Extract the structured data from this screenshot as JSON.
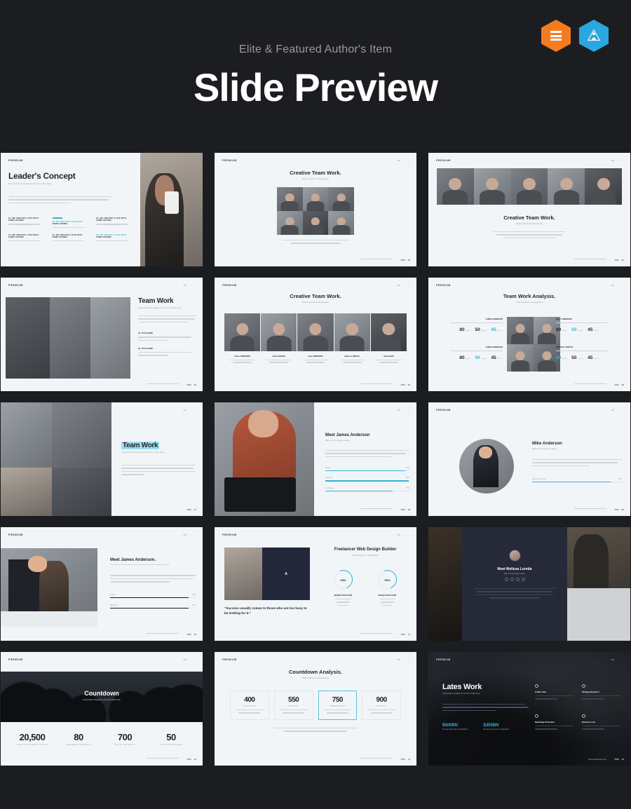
{
  "header": {
    "subtitle": "Elite & Featured Author's Item",
    "title": "Slide Preview",
    "badges": [
      {
        "name": "envato-elite-badge",
        "color": "#f47c20"
      },
      {
        "name": "featured-author-badge",
        "color": "#2ba6de"
      }
    ]
  },
  "slides": [
    {
      "id": "slide-1",
      "brand": "PREMIUM",
      "title": "Leader's Concept",
      "subtitle": "Presentation Template by Premium Slide Shop",
      "nav": "PR",
      "page": "01",
      "columns": [
        {
          "label": "01. WE CREATED A SITE WITH",
          "label2": "FUNNY LETTERS",
          "accent": false
        },
        {
          "label": "02. WE CREATED A SITE WITH",
          "label2": "FUNNY LETTERS",
          "accent": true
        },
        {
          "label": "03. WE CREATED A SITE WITH",
          "label2": "FUNNY LETTERS",
          "accent": false
        },
        {
          "label": "04. WE CREATED A SITE WITH",
          "label2": "FUNNY LETTERS",
          "accent": false
        },
        {
          "label": "05. WE CREATED A SITE WITH",
          "label2": "FUNNY LETTERS",
          "accent": false
        },
        {
          "label": "06. WE CREATED A SITE WITH",
          "label2": "FUNNY LETTERS",
          "accent": true
        }
      ]
    },
    {
      "id": "slide-2",
      "brand": "PREMIUM",
      "title": "Creative Team Work.",
      "subtitle": "Slide Analysis & Infographics",
      "page": "02"
    },
    {
      "id": "slide-3",
      "brand": "PREMIUM",
      "title": "Creative Team Work.",
      "subtitle": "Slide Analysis & Infographics",
      "page": "03"
    },
    {
      "id": "slide-4",
      "brand": "PREMIUM",
      "title": "Team Work",
      "subtitle": "Presentation Template by Premium Slide Shop",
      "items": [
        {
          "label": "01. TITLE HERE"
        },
        {
          "label": "02. TITLE HERE"
        }
      ],
      "page": "04"
    },
    {
      "id": "slide-5",
      "brand": "PREMIUM",
      "title": "Creative Team Work.",
      "subtitle": "Slide Analysis & Infographics",
      "members": [
        {
          "name": "James ANDERSON",
          "role": "Lorem ipsum dolor sit amet"
        },
        {
          "name": "David ARCHER",
          "role": "Lorem ipsum dolor sit amet"
        },
        {
          "name": "Sean ANDERSON",
          "role": "Lorem ipsum dolor sit amet"
        },
        {
          "name": "Melissa LORETTA",
          "role": "Lorem ipsum dolor sit amet"
        },
        {
          "name": "Sean DAVID",
          "role": "Lorem ipsum dolor sit amet"
        }
      ],
      "page": "05"
    },
    {
      "id": "slide-6",
      "brand": "PREMIUM",
      "title": "Team Work Analysis.",
      "subtitle": "Slide Analysis & Infographics",
      "people": [
        {
          "name": "JAMES ANDERSON",
          "values": [
            "80",
            "50",
            "45"
          ],
          "accentIndex": 2
        },
        {
          "name": "BILLY ANDERSON",
          "values": [
            "80",
            "50",
            "45"
          ],
          "accentIndex": 1
        },
        {
          "name": "JAMES ANDERSON",
          "values": [
            "80",
            "50",
            "45"
          ],
          "accentIndex": 1
        },
        {
          "name": "MELISSA LORETTA",
          "values": [
            "80",
            "50",
            "45"
          ],
          "accentIndex": 0
        }
      ],
      "units": [
        "Projects",
        "Progress",
        "Success"
      ],
      "page": "06"
    },
    {
      "id": "slide-7",
      "brand": "PREMIUM",
      "title": "Team Work",
      "subtitle": "Presentation Template by Premium Slide Shop",
      "page": "07"
    },
    {
      "id": "slide-8",
      "brand": "PREMIUM",
      "title": "Meet James Anderson",
      "subtitle": "Elite & Technology Leader",
      "bars": [
        {
          "label": "Design",
          "value": "90%",
          "pct": 90
        },
        {
          "label": "Marketing",
          "value": "85%",
          "pct": 85
        },
        {
          "label": "Technology",
          "value": "75%",
          "pct": 75
        }
      ],
      "page": "08"
    },
    {
      "id": "slide-9",
      "brand": "PREMIUM",
      "title": "Mike Anderson",
      "subtitle": "Elite & Technology Leader",
      "bars": [
        {
          "label": "Business Process",
          "value": "80%",
          "pct": 80
        }
      ],
      "page": "09"
    },
    {
      "id": "slide-10",
      "brand": "PREMIUM",
      "title": "Meet James Anderson.",
      "subtitle": "Presentation Template by Premium",
      "bars": [
        {
          "label": "Design",
          "value": "90%",
          "pct": 90
        },
        {
          "label": "Marketing",
          "value": "80%",
          "pct": 80
        }
      ],
      "page": "10"
    },
    {
      "id": "slide-11",
      "brand": "PREMIUM",
      "title": "Freelancer Web Design Builder",
      "subtitle": "Slide Analysis & Infographics",
      "quote": "\"Success usually comes to those who are too busy to be looking for it.\"",
      "rings": [
        {
          "pct": "65%",
          "caption": "Lorem ipsum dolor",
          "label": "DESIGN STRUCTURE"
        },
        {
          "pct": "90%",
          "caption": "Lorem ipsum dolor",
          "label": "DESIGN STRUCTURE"
        }
      ],
      "page": "11"
    },
    {
      "id": "slide-12",
      "brand": "PREMIUM",
      "title": "Meet Melissa Loretta",
      "subtitle": "Elite & Technology Leader",
      "page": "12"
    },
    {
      "id": "slide-13",
      "brand": "PREMIUM",
      "title": "Countdown",
      "subtitle": "Presentation Template by Premium Slide Shop",
      "stats": [
        {
          "value": "20,500",
          "label": "HAPPY BUSINESS CLIENTS",
          "accent": false
        },
        {
          "value": "80",
          "label": "AWARDED PROJECTS",
          "accent": false
        },
        {
          "value": "700",
          "label": "SOCIAL PROJECTS",
          "accent": true
        },
        {
          "value": "50",
          "label": "SOLUTION PROCESS",
          "accent": false
        }
      ],
      "page": "13"
    },
    {
      "id": "slide-14",
      "brand": "PREMIUM",
      "title": "Countdown Analysis.",
      "subtitle": "Slide Analysis & Infographics",
      "cards": [
        {
          "value": "400",
          "label": "PROJECTS",
          "caption": "Lorem ipsum dolor sit amet consectetur",
          "highlight": false
        },
        {
          "value": "550",
          "label": "CLIENTS",
          "caption": "Lorem ipsum dolor sit amet consectetur",
          "highlight": false
        },
        {
          "value": "750",
          "label": "PROMOTIONS",
          "caption": "Lorem ipsum dolor sit amet consectetur",
          "highlight": true
        },
        {
          "value": "900",
          "label": "SOCIALS",
          "caption": "Lorem ipsum dolor sit amet consectetur",
          "highlight": false
        }
      ],
      "page": "14"
    },
    {
      "id": "slide-15",
      "brand": "PREMIUM",
      "title": "Lates Work",
      "subtitle": "Presentation Template by Premium Slide Shop",
      "stats": [
        {
          "value": "$500BN",
          "label": "We take deep notice of infographics"
        },
        {
          "value": "$350BN",
          "label": "We take deep notice of infographics"
        }
      ],
      "features": [
        {
          "icon": "briefcase-icon",
          "title": "Coffee Time",
          "desc": "Lorem ipsum dolor sit amet consectetur"
        },
        {
          "icon": "settings-icon",
          "title": "Strategy Research",
          "desc": "Lorem ipsum dolor sit amet consectetur"
        },
        {
          "icon": "rocket-icon",
          "title": "Marketing Promotion",
          "desc": "Lorem ipsum dolor sit amet consectetur"
        },
        {
          "icon": "chat-icon",
          "title": "Business Line",
          "desc": "Lorem ipsum dolor sit amet consectetur"
        }
      ],
      "url": "www.websiteshop.com",
      "page": "15"
    }
  ]
}
